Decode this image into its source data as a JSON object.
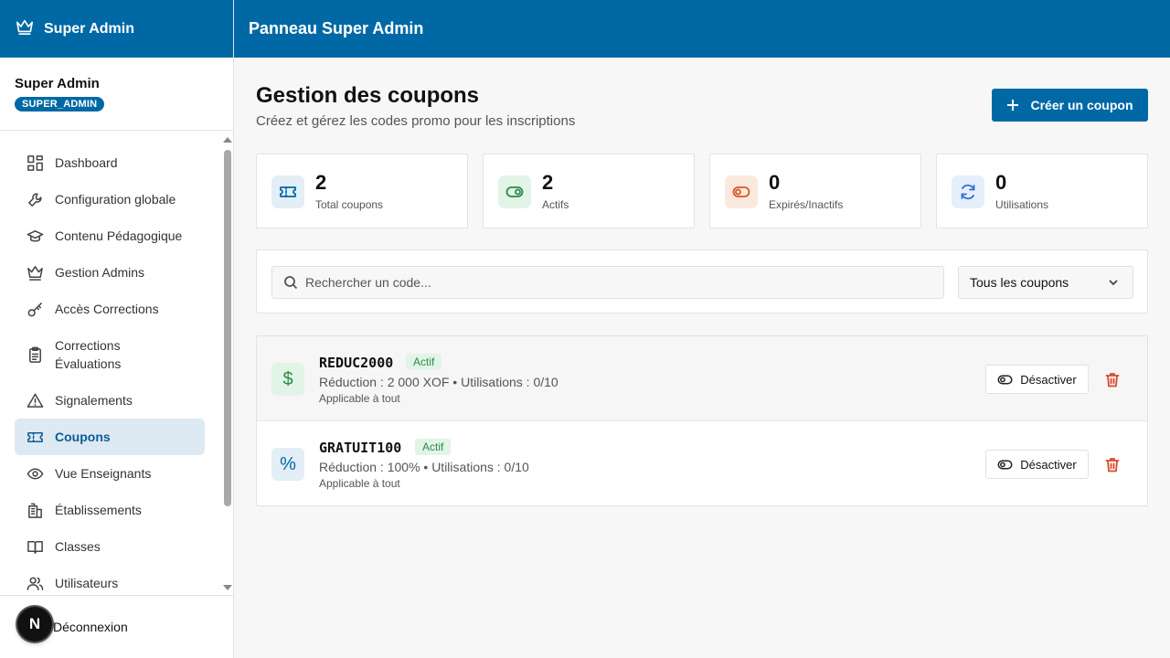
{
  "brand": {
    "title": "Super Admin",
    "icon": "crown-icon"
  },
  "header": {
    "title": "Panneau Super Admin"
  },
  "user": {
    "name": "Super Admin",
    "role": "SUPER_ADMIN"
  },
  "sidebar": {
    "items": [
      {
        "label": "Dashboard",
        "icon": "dashboard-icon"
      },
      {
        "label": "Configuration globale",
        "icon": "wrench-icon"
      },
      {
        "label": "Contenu Pédagogique",
        "icon": "graduation-cap-icon"
      },
      {
        "label": "Gestion Admins",
        "icon": "crown-icon"
      },
      {
        "label": "Accès Corrections",
        "icon": "key-icon"
      },
      {
        "label": "Corrections Évaluations",
        "icon": "clipboard-icon"
      },
      {
        "label": "Signalements",
        "icon": "warning-icon"
      },
      {
        "label": "Coupons",
        "icon": "ticket-icon",
        "active": true
      },
      {
        "label": "Vue Enseignants",
        "icon": "eye-icon"
      },
      {
        "label": "Établissements",
        "icon": "building-icon"
      },
      {
        "label": "Classes",
        "icon": "book-icon"
      },
      {
        "label": "Utilisateurs",
        "icon": "users-icon"
      }
    ],
    "logout_label": "Déconnexion",
    "avatar_letter": "N"
  },
  "page": {
    "title": "Gestion des coupons",
    "subtitle": "Créez et gérez les codes promo pour les inscriptions",
    "create_label": "Créer un coupon"
  },
  "stats": [
    {
      "value": "2",
      "label": "Total coupons",
      "icon": "ticket-icon",
      "color": "#0069a5",
      "bg": "#e3eef7"
    },
    {
      "value": "2",
      "label": "Actifs",
      "icon": "toggle-on-icon",
      "color": "#2a8a47",
      "bg": "#e2f4e7"
    },
    {
      "value": "0",
      "label": "Expirés/Inactifs",
      "icon": "toggle-off-icon",
      "color": "#d9561f",
      "bg": "#fbe9df"
    },
    {
      "value": "0",
      "label": "Utilisations",
      "icon": "refresh-icon",
      "color": "#2f6fd6",
      "bg": "#e5eefb"
    }
  ],
  "filters": {
    "search_placeholder": "Rechercher un code...",
    "select_value": "Tous les coupons"
  },
  "coupons": [
    {
      "code": "REDUC2000",
      "status": "Actif",
      "meta": "Réduction : 2 000 XOF • Utilisations : 0/10",
      "scope": "Applicable à tout",
      "icon": "$",
      "icon_color": "#2a8a47",
      "icon_bg": "#e2f4e7",
      "action_label": "Désactiver"
    },
    {
      "code": "GRATUIT100",
      "status": "Actif",
      "meta": "Réduction : 100% • Utilisations : 0/10",
      "scope": "Applicable à tout",
      "icon": "%",
      "icon_color": "#0069a5",
      "icon_bg": "#e3eef7",
      "action_label": "Désactiver"
    }
  ]
}
